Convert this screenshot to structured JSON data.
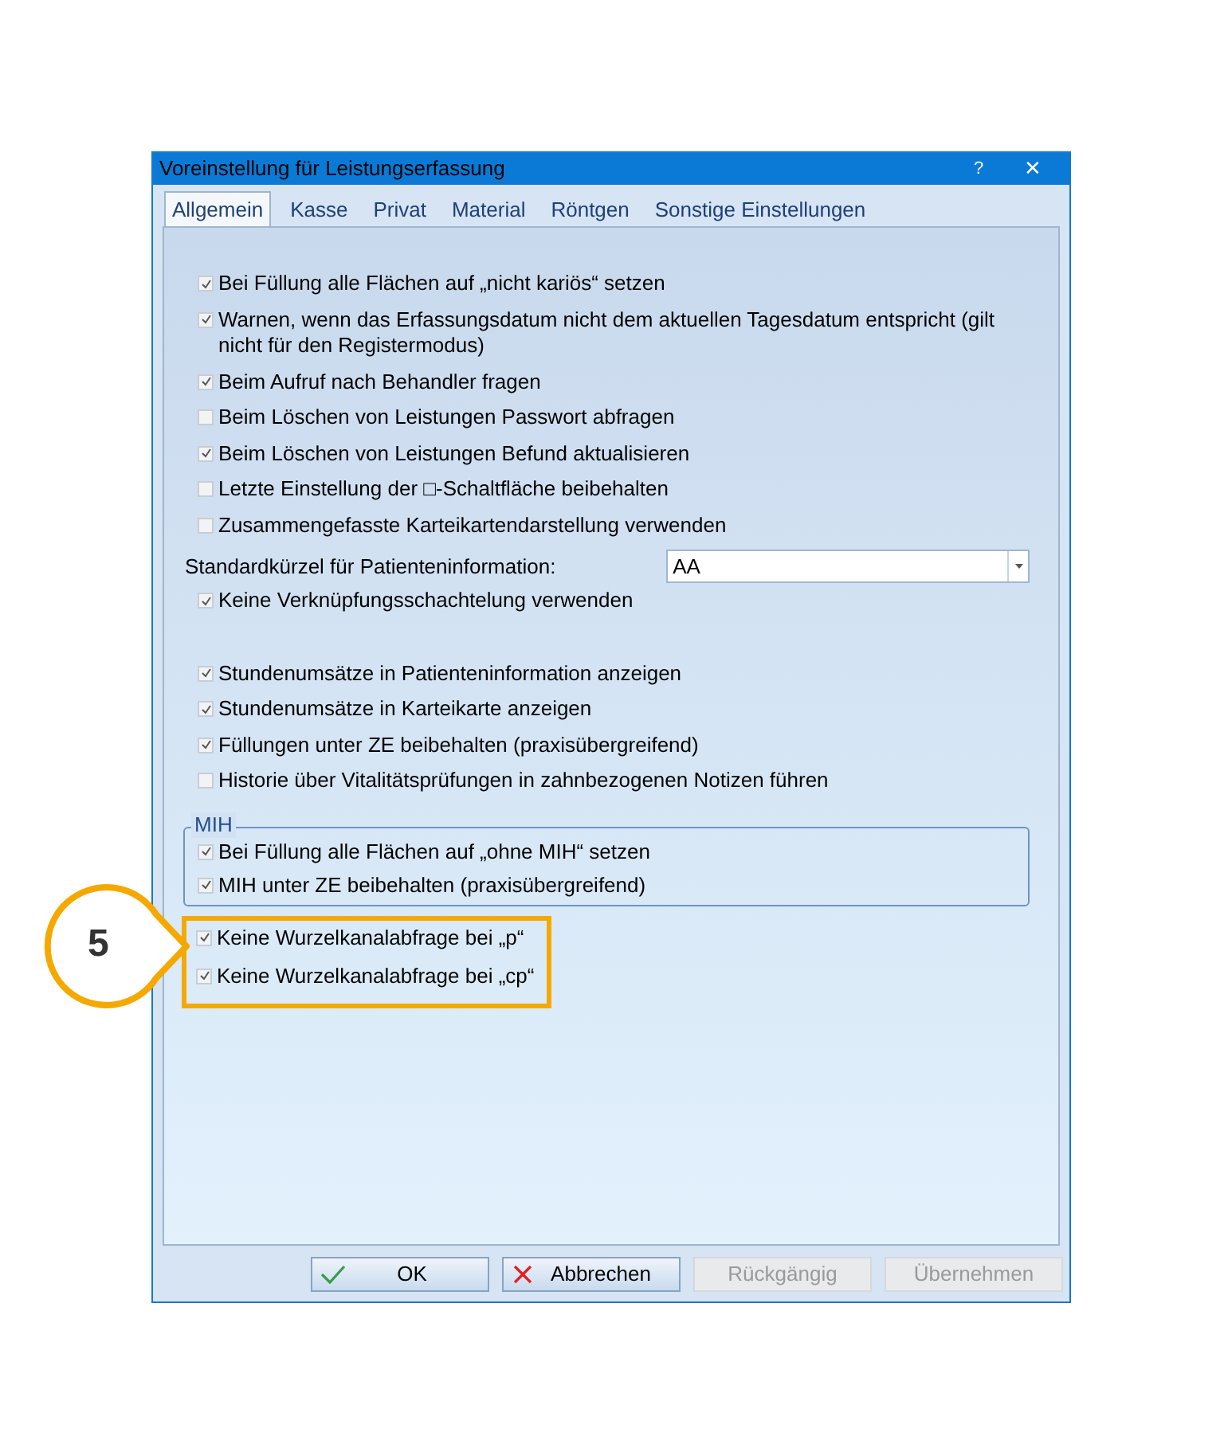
{
  "window": {
    "title": "Voreinstellung für Leistungserfassung",
    "help": "?",
    "close": "✕"
  },
  "tabs": [
    {
      "label": "Allgemein",
      "selected": true
    },
    {
      "label": "Kasse",
      "selected": false
    },
    {
      "label": "Privat",
      "selected": false
    },
    {
      "label": "Material",
      "selected": false
    },
    {
      "label": "Röntgen",
      "selected": false
    },
    {
      "label": "Sonstige Einstellungen",
      "selected": false
    }
  ],
  "general_options": [
    {
      "kind": "checkbox",
      "label": "Bei Füllung alle Flächen auf „nicht kariös“ setzen",
      "checked": true
    },
    {
      "kind": "checkbox",
      "label": "Warnen, wenn das Erfassungsdatum nicht dem aktuellen Tagesdatum entspricht (gilt nicht für den Registermodus)",
      "checked": true
    },
    {
      "kind": "checkbox",
      "label": "Beim Aufruf nach Behandler fragen",
      "checked": true
    },
    {
      "kind": "checkbox",
      "label": "Beim Löschen von Leistungen Passwort abfragen",
      "checked": false
    },
    {
      "kind": "checkbox",
      "label": "Beim Löschen von Leistungen Befund aktualisieren",
      "checked": true
    },
    {
      "kind": "checkbox",
      "label": "Letzte Einstellung der □-Schaltfläche beibehalten",
      "checked": false
    },
    {
      "kind": "checkbox",
      "label": "Zusammengefasste Karteikartendarstellung verwenden",
      "checked": false
    },
    {
      "kind": "combo",
      "label": "Standardkürzel für Patienteninformation:",
      "value": "AA"
    },
    {
      "kind": "checkbox",
      "label": "Keine Verknüpfungsschachtelung verwenden",
      "checked": true
    }
  ],
  "display_options": [
    {
      "label": "Stundenumsätze in Patienteninformation anzeigen",
      "checked": true
    },
    {
      "label": "Stundenumsätze in Karteikarte anzeigen",
      "checked": true
    },
    {
      "label": "Füllungen unter ZE beibehalten (praxisübergreifend)",
      "checked": true
    },
    {
      "label": "Historie über Vitalitätsprüfungen in zahnbezogenen Notizen führen",
      "checked": false
    }
  ],
  "mih_group": {
    "title": "MIH",
    "options": [
      {
        "label": "Bei Füllung alle Flächen auf „ohne MIH“ setzen",
        "checked": true
      },
      {
        "label": "MIH unter ZE beibehalten (praxisübergreifend)",
        "checked": true
      }
    ]
  },
  "highlighted_options": {
    "callout": "5",
    "options": [
      {
        "label": "Keine Wurzelkanalabfrage bei „p“",
        "checked": true
      },
      {
        "label": "Keine Wurzelkanalabfrage bei „cp“",
        "checked": true
      }
    ]
  },
  "buttons": [
    {
      "kind": "ok",
      "label": "OK",
      "disabled": false
    },
    {
      "kind": "cancel",
      "label": "Abbrechen",
      "disabled": false
    },
    {
      "kind": "plain",
      "label": "Rückgängig",
      "disabled": true
    },
    {
      "kind": "plain",
      "label": "Übernehmen",
      "disabled": true
    }
  ]
}
